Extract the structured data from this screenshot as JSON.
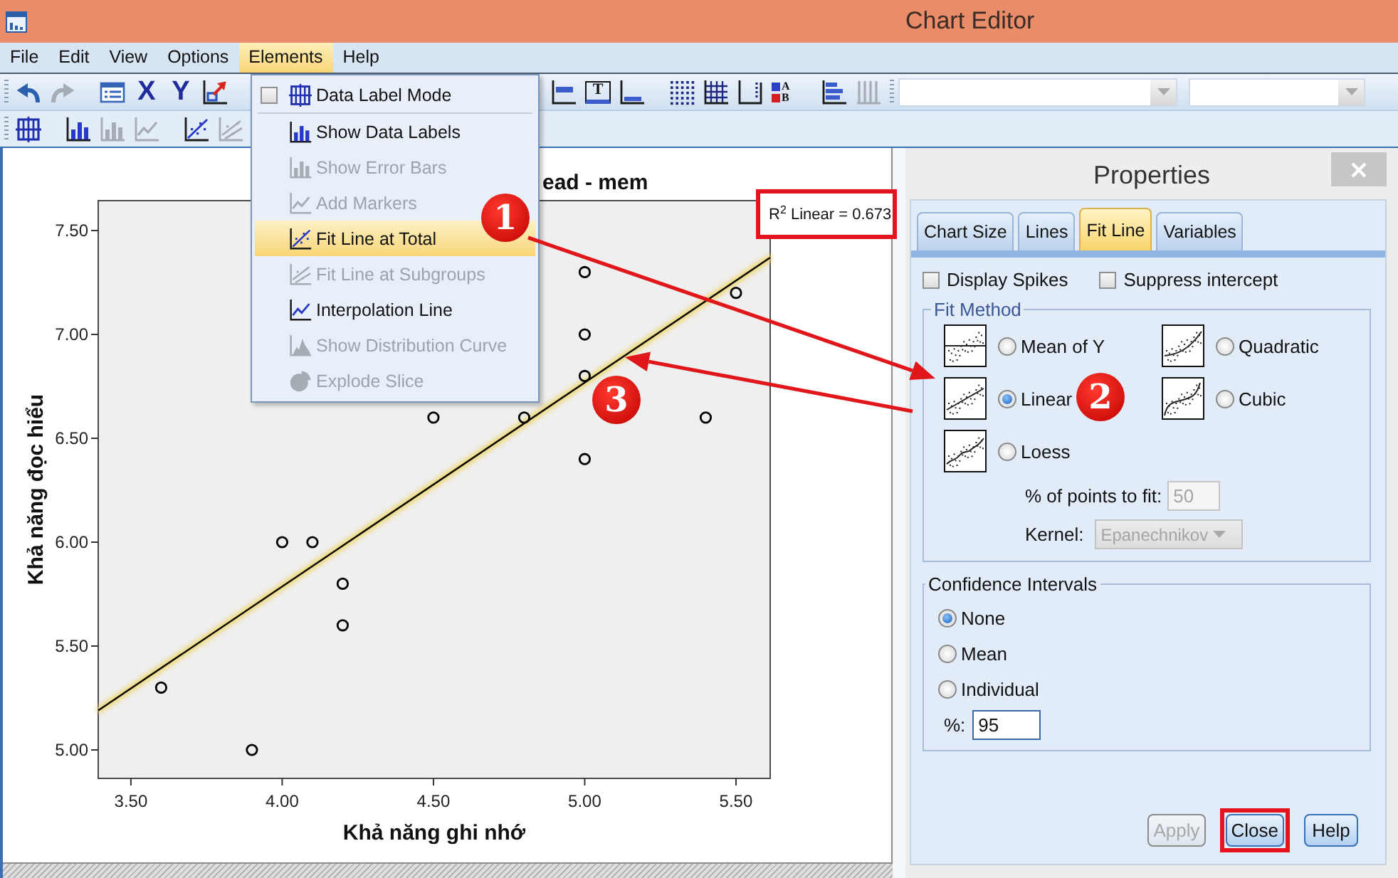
{
  "window": {
    "title": "Chart Editor"
  },
  "menu_bar": [
    {
      "label": "File",
      "selected": false
    },
    {
      "label": "Edit",
      "selected": false
    },
    {
      "label": "View",
      "selected": false
    },
    {
      "label": "Options",
      "selected": false
    },
    {
      "label": "Elements",
      "selected": true
    },
    {
      "label": "Help",
      "selected": false
    }
  ],
  "toolbar": {
    "row_1_left": [
      [
        {
          "kind": "undo",
          "disabled": false
        },
        {
          "kind": "redo",
          "disabled": true
        }
      ],
      [
        {
          "kind": "list",
          "disabled": false
        },
        {
          "kind": "letter",
          "text": "X",
          "disabled": false
        },
        {
          "kind": "letter",
          "text": "Y",
          "disabled": false
        },
        {
          "kind": "scale",
          "disabled": false
        }
      ]
    ],
    "row_1_right": [
      [
        {
          "kind": "axis-bar",
          "disabled": false
        },
        {
          "kind": "textbox",
          "text": "T",
          "disabled": false
        },
        {
          "kind": "axis-line",
          "disabled": false
        }
      ],
      [
        {
          "kind": "dot-grid",
          "disabled": false
        },
        {
          "kind": "grid",
          "disabled": false
        },
        {
          "kind": "axis-frame",
          "disabled": false
        },
        {
          "kind": "legend",
          "text": "AB",
          "disabled": false
        }
      ],
      [
        {
          "kind": "hbars",
          "disabled": false
        },
        {
          "kind": "vbars",
          "disabled": true
        }
      ]
    ],
    "dropdowns": [
      {
        "disabled": true
      },
      {
        "disabled": true
      }
    ],
    "row_2": [
      [
        {
          "kind": "crosshair",
          "disabled": false
        }
      ],
      [
        {
          "kind": "bars",
          "disabled": false
        },
        {
          "kind": "bars",
          "disabled": true
        },
        {
          "kind": "line",
          "disabled": true
        }
      ],
      [
        {
          "kind": "scatter-line",
          "disabled": false
        },
        {
          "kind": "scatter-lines",
          "disabled": true
        }
      ]
    ]
  },
  "elements_menu": {
    "sections": [
      [
        {
          "label": "Data Label Mode",
          "kind": "crosshair",
          "checked": false,
          "disabled": false,
          "selected": false
        }
      ],
      [
        {
          "label": "Show Data Labels",
          "kind": "bars",
          "disabled": false,
          "selected": false
        },
        {
          "label": "Show Error Bars",
          "kind": "bars",
          "disabled": true,
          "selected": false
        },
        {
          "label": "Add Markers",
          "kind": "line",
          "disabled": true,
          "selected": false
        },
        {
          "label": "Fit Line at Total",
          "kind": "scatter-line",
          "disabled": false,
          "selected": true
        },
        {
          "label": "Fit Line at Subgroups",
          "kind": "scatter-lines",
          "disabled": true,
          "selected": false
        },
        {
          "label": "Interpolation Line",
          "kind": "line",
          "disabled": false,
          "selected": false
        },
        {
          "label": "Show Distribution Curve",
          "kind": "area",
          "disabled": true,
          "selected": false
        },
        {
          "label": "Explode Slice",
          "kind": "pie",
          "disabled": true,
          "selected": false
        }
      ]
    ]
  },
  "chart": {
    "chart_data": {
      "type": "scatter",
      "title": "ead - mem",
      "xlabel": "Khả năng ghi nhớ",
      "ylabel": "Khả năng đọc hiểu",
      "x": [
        3.392,
        3.6,
        3.9,
        4.0,
        4.1,
        4.2,
        4.2,
        4.5,
        4.8,
        5.0,
        5.0,
        5.0,
        5.0,
        5.4,
        5.5,
        5.613
      ],
      "series": [
        {
          "color": "#000000",
          "values": [
            null,
            5.3,
            5.0,
            6.0,
            6.0,
            5.8,
            5.6,
            6.6,
            6.6,
            7.3,
            7.0,
            6.8,
            6.4,
            6.6,
            7.2,
            null
          ]
        },
        {
          "type": "line",
          "color": "#000000",
          "values": [
            5.19,
            null,
            null,
            null,
            null,
            null,
            null,
            null,
            null,
            null,
            null,
            null,
            null,
            null,
            null,
            7.37
          ]
        }
      ],
      "xlim": [
        3.392,
        5.613
      ],
      "ylim": [
        4.863,
        7.644
      ],
      "xticks": [
        {
          "value": 3.5,
          "label": "3.50"
        },
        {
          "value": 4.0,
          "label": "4.00"
        },
        {
          "value": 4.5,
          "label": "4.50"
        },
        {
          "value": 5.0,
          "label": "5.00"
        },
        {
          "value": 5.5,
          "label": "5.50"
        }
      ],
      "yticks": [
        {
          "value": 5.0,
          "label": "5.00"
        },
        {
          "value": 5.5,
          "label": "5.50"
        },
        {
          "value": 6.0,
          "label": "6.00"
        },
        {
          "value": 6.5,
          "label": "6.50"
        },
        {
          "value": 7.0,
          "label": "7.00"
        },
        {
          "value": 7.5,
          "label": "7.50"
        }
      ]
    },
    "fit_line": {
      "label": "R$^{2}$ Linear = 0.673",
      "selected": true,
      "highlighted": true
    }
  },
  "properties": {
    "title": "Properties",
    "tabs": [
      {
        "label": "Chart Size",
        "selected": false
      },
      {
        "label": "Lines",
        "selected": false
      },
      {
        "label": "Fit Line",
        "selected": true
      },
      {
        "label": "Variables",
        "selected": false
      }
    ],
    "options": [
      {
        "label": "Display Spikes",
        "checked": false
      },
      {
        "label": "Suppress intercept",
        "checked": false
      }
    ],
    "fit_method": {
      "title": "Fit Method",
      "methods": [
        {
          "label": "Mean of Y",
          "kind": "mean",
          "selected": false
        },
        {
          "label": "Quadratic",
          "kind": "quadratic",
          "selected": false
        },
        {
          "label": "Linear",
          "kind": "linear",
          "selected": true
        },
        {
          "label": "Cubic",
          "kind": "cubic",
          "selected": false
        },
        {
          "label": "Loess",
          "kind": "loess",
          "selected": false
        }
      ],
      "points_to_fit": {
        "label": "% of points to fit:",
        "value": "50",
        "disabled": true
      },
      "kernel": {
        "label": "Kernel:",
        "value": "Epanechnikov",
        "disabled": true
      }
    },
    "confidence_intervals": {
      "title": "Confidence Intervals",
      "choices": [
        {
          "label": "None",
          "selected": true
        },
        {
          "label": "Mean",
          "selected": false
        },
        {
          "label": "Individual",
          "selected": false
        }
      ],
      "percent": {
        "label": "%:",
        "value": "95"
      }
    },
    "buttons": [
      {
        "label": "Apply",
        "disabled": true,
        "highlighted": false
      },
      {
        "label": "Close",
        "disabled": false,
        "highlighted": true
      },
      {
        "label": "Help",
        "disabled": false,
        "highlighted": false
      }
    ]
  },
  "callouts": [
    {
      "text": "1"
    },
    {
      "text": "2"
    },
    {
      "text": "3"
    }
  ]
}
